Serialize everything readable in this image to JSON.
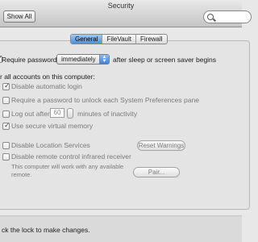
{
  "window": {
    "title": "Security"
  },
  "toolbar": {
    "show_all_label": "Show All",
    "search_placeholder": ""
  },
  "tabs": [
    {
      "label": "General",
      "active": true
    },
    {
      "label": "FileVault",
      "active": false
    },
    {
      "label": "Firewall",
      "active": false
    }
  ],
  "general": {
    "require_password": {
      "label": "Require password",
      "selected": "immediately",
      "suffix": "after sleep or screen saver begins",
      "checked": true
    },
    "all_accounts_header": "r all accounts on this computer:",
    "options": [
      {
        "label": "Disable automatic login",
        "checked": true,
        "enabled": false
      },
      {
        "label": "Require a password to unlock each System Preferences pane",
        "checked": false,
        "enabled": false
      },
      {
        "label": "Log out after",
        "checked": false,
        "enabled": false,
        "value": "60",
        "suffix": "minutes of inactivity"
      },
      {
        "label": "Use secure virtual memory",
        "checked": true,
        "enabled": false
      }
    ],
    "location_services": {
      "label": "Disable Location Services",
      "checked": false,
      "button": "Reset Warnings"
    },
    "remote_control": {
      "label": "Disable remote control infrared receiver",
      "checked": false,
      "note_line1": "This computer will work with any available",
      "note_line2": "remote.",
      "button": "Pair..."
    }
  },
  "footer": {
    "lock_text": "ck the lock to make changes."
  },
  "colors": {
    "accent": "#4c90dd",
    "background": "#e8e8e8"
  }
}
